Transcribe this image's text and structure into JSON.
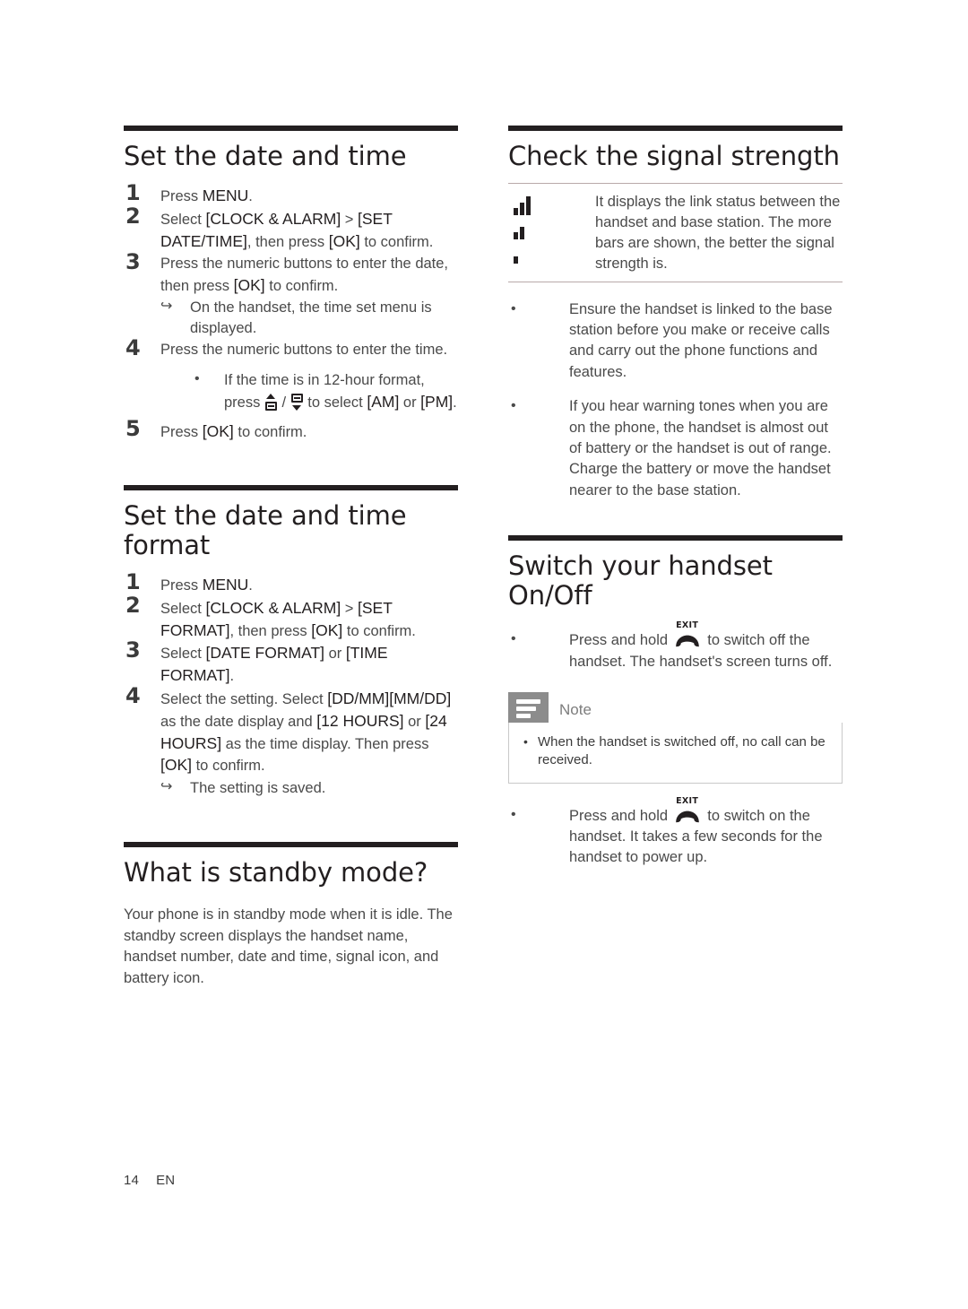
{
  "page": {
    "footer_page_number": "14",
    "footer_language": "EN"
  },
  "left_column": {
    "sections": [
      {
        "id": "set-date-time",
        "heading": "Set the date and time",
        "steps": [
          {
            "num": "1",
            "parts": [
              {
                "t": "Press "
              },
              {
                "k": "MENU"
              },
              {
                "t": "."
              }
            ]
          },
          {
            "num": "2",
            "parts": [
              {
                "t": "Select "
              },
              {
                "k": "[CLOCK & ALARM]"
              },
              {
                "t": " > "
              },
              {
                "k": "[SET DATE/TIME]"
              },
              {
                "t": ", then press "
              },
              {
                "k": "[OK]"
              },
              {
                "t": " to confirm."
              }
            ]
          },
          {
            "num": "3",
            "parts": [
              {
                "t": "Press the numeric buttons to enter the date, then press "
              },
              {
                "k": "[OK]"
              },
              {
                "t": " to confirm."
              }
            ],
            "result": "On the handset, the time set menu is displayed."
          },
          {
            "num": "4",
            "parts": [
              {
                "t": "Press the numeric buttons to enter the time."
              }
            ],
            "subbullet_pre": "If the time is in 12-hour format, press ",
            "subbullet_mid": " / ",
            "subbullet_post_a": " to select ",
            "subbullet_am": "[AM]",
            "subbullet_or": " or ",
            "subbullet_pm": "[PM]",
            "subbullet_end": "."
          },
          {
            "num": "5",
            "parts": [
              {
                "t": "Press "
              },
              {
                "k": "[OK]"
              },
              {
                "t": " to confirm."
              }
            ]
          }
        ]
      },
      {
        "id": "set-date-time-format",
        "heading": "Set the date and time format",
        "steps": [
          {
            "num": "1",
            "parts": [
              {
                "t": "Press "
              },
              {
                "k": "MENU"
              },
              {
                "t": "."
              }
            ]
          },
          {
            "num": "2",
            "parts": [
              {
                "t": "Select "
              },
              {
                "k": "[CLOCK & ALARM]"
              },
              {
                "t": " > "
              },
              {
                "k": "[SET FORMAT]"
              },
              {
                "t": ", then press "
              },
              {
                "k": "[OK]"
              },
              {
                "t": " to confirm."
              }
            ]
          },
          {
            "num": "3",
            "parts": [
              {
                "t": "Select "
              },
              {
                "k": "[DATE FORMAT]"
              },
              {
                "t": " or "
              },
              {
                "k": "[TIME FORMAT]"
              },
              {
                "t": "."
              }
            ]
          },
          {
            "num": "4",
            "parts": [
              {
                "t": "Select the setting. Select "
              },
              {
                "k": "[DD/MM][MM/DD]"
              },
              {
                "t": " as the date display and "
              },
              {
                "k": "[12 HOURS]"
              },
              {
                "t": " or "
              },
              {
                "k": "[24 HOURS]"
              },
              {
                "t": " as the time display. Then press "
              },
              {
                "k": "[OK]"
              },
              {
                "t": " to confirm."
              }
            ],
            "result": "The setting is saved."
          }
        ]
      },
      {
        "id": "what-is-standby-mode",
        "heading": "What is standby mode?",
        "body": "Your phone is in standby mode when it is idle. The standby screen displays the handset name, handset number, date and time, signal icon, and battery icon."
      }
    ]
  },
  "right_column": {
    "sections": [
      {
        "id": "check-signal-strength",
        "heading": "Check the signal strength",
        "signal_table": {
          "icons": [
            {
              "name": "signal-bars-3-icon",
              "bars": 3
            },
            {
              "name": "signal-bars-2-icon",
              "bars": 2
            },
            {
              "name": "signal-bars-1-icon",
              "bars": 1
            }
          ],
          "description": "It displays the link status between the handset and base station. The more bars are shown, the better the signal strength is."
        },
        "bullets": [
          "Ensure the handset is linked to the base station before you make or receive calls and carry out the phone functions and features.",
          "If you hear warning tones when you are on the phone, the handset is almost out of battery or the handset is out of range. Charge the battery or move the handset nearer to the base station."
        ]
      },
      {
        "id": "switch-handset-on-off",
        "heading": "Switch your handset On/Off",
        "bullet_off_pre": "Press and hold ",
        "bullet_off_post": " to switch off the handset. The handset's screen turns off.",
        "bullet_on_pre": "Press and hold ",
        "bullet_on_post": " to switch on the handset. It takes a few seconds for the handset to power up.",
        "exit_key_label": "EXIT",
        "note": {
          "title": "Note",
          "items": [
            "When the handset is switched off, no call can be received."
          ]
        }
      }
    ]
  }
}
